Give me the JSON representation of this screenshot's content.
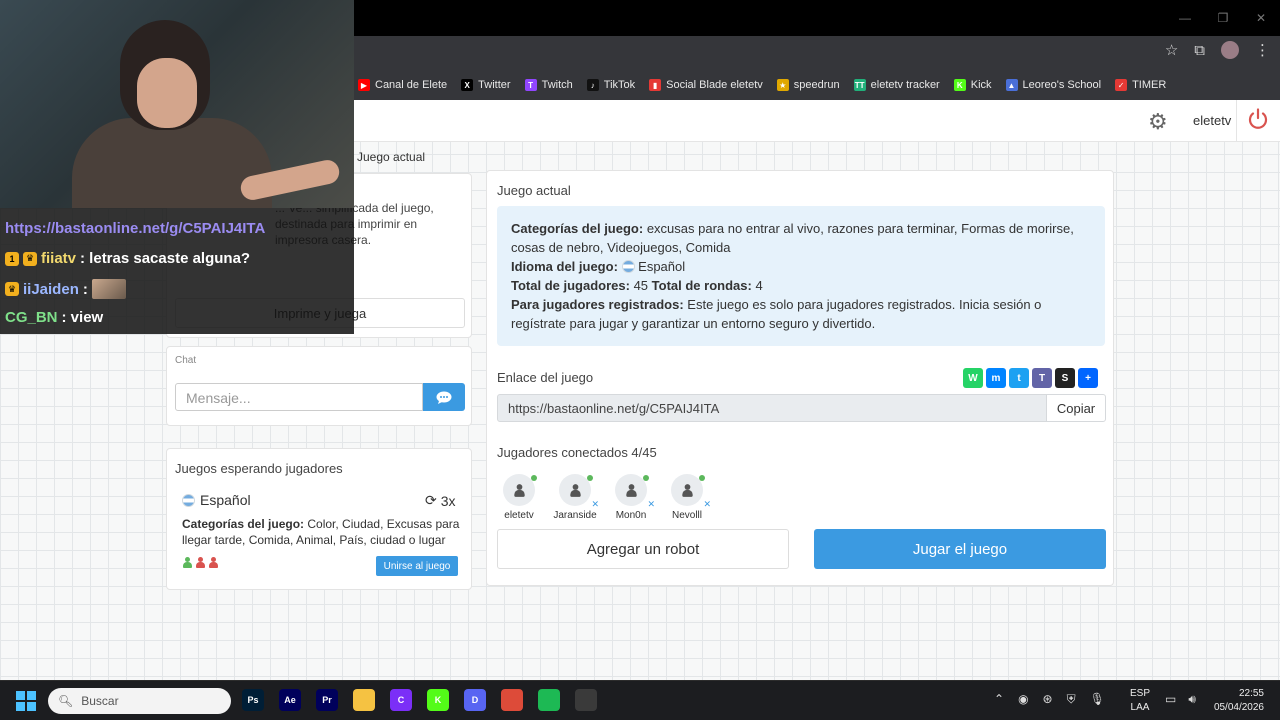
{
  "browser": {
    "bookmarks": [
      {
        "label": "Canal de Elete",
        "icon": "youtube-icon",
        "color": "#ff0000",
        "glyph": "▶"
      },
      {
        "label": "Twitter",
        "icon": "x-icon",
        "color": "#000000",
        "glyph": "X"
      },
      {
        "label": "Twitch",
        "icon": "twitch-icon",
        "color": "#9146ff",
        "glyph": "T"
      },
      {
        "label": "TikTok",
        "icon": "tiktok-icon",
        "color": "#111111",
        "glyph": "♪"
      },
      {
        "label": "Social Blade eletetv",
        "icon": "socialblade-icon",
        "color": "#e53935",
        "glyph": "▮"
      },
      {
        "label": "speedrun",
        "icon": "speedrun-icon",
        "color": "#e0a800",
        "glyph": "★"
      },
      {
        "label": "eletetv tracker",
        "icon": "tracker-icon",
        "color": "#21b07a",
        "glyph": "TT"
      },
      {
        "label": "Kick",
        "icon": "kick-icon",
        "color": "#53fc18",
        "glyph": "K"
      },
      {
        "label": "Leoreo's School",
        "icon": "school-icon",
        "color": "#4a6fd8",
        "glyph": "▲"
      },
      {
        "label": "TIMER",
        "icon": "timer-icon",
        "color": "#e53935",
        "glyph": "✓"
      }
    ]
  },
  "nav": {
    "username": "eletetv"
  },
  "breadcrumb": "Juego actual",
  "print_card": {
    "description": "... Ve... simplificada del juego, destinada para imprimir en impresora casera.",
    "button": "Imprime y juega"
  },
  "chat": {
    "title": "Chat",
    "placeholder": "Mensaje..."
  },
  "waiting": {
    "title": "Juegos esperando jugadores",
    "language": "Español",
    "rounds": "3x",
    "categories_label": "Categorías del juego:",
    "categories": "Color, Ciudad, Excusas para llegar tarde, Comida, Animal, País, ciudad o lugar",
    "players_colors": [
      "#5cb85c",
      "#d9534f",
      "#d9534f"
    ],
    "join_button": "Unirse al juego"
  },
  "game": {
    "title": "Juego actual",
    "categories_label": "Categorías del juego:",
    "categories": "excusas para no entrar al vivo, razones para terminar, Formas de morirse, cosas de nebro, Videojuegos, Comida",
    "language_label": "Idioma del juego:",
    "language": "Español",
    "players_label": "Total de jugadores:",
    "players_total": "45",
    "rounds_label": "Total de rondas:",
    "rounds_total": "4",
    "registered_label": "Para jugadores registrados:",
    "registered_text": "Este juego es solo para jugadores registrados. Inicia sesión o regístrate para jugar y garantizar un entorno seguro y divertido.",
    "link_label": "Enlace del juego",
    "link": "https://bastaonline.net/g/C5PAIJ4ITA",
    "copy_button": "Copiar",
    "connected_label": "Jugadores conectados 4/45",
    "players": [
      {
        "name": "eletetv",
        "host": true
      },
      {
        "name": "Jaranside",
        "host": false
      },
      {
        "name": "Mon0n",
        "host": false
      },
      {
        "name": "Nevolll",
        "host": false
      }
    ],
    "robot_button": "Agregar un robot",
    "play_button": "Jugar el juego",
    "share_icons": [
      {
        "name": "whatsapp-icon",
        "color": "#25d366",
        "glyph": "W"
      },
      {
        "name": "messenger-icon",
        "color": "#0084ff",
        "glyph": "m"
      },
      {
        "name": "twitter-icon",
        "color": "#1da1f2",
        "glyph": "t"
      },
      {
        "name": "teams-icon",
        "color": "#6264a7",
        "glyph": "T"
      },
      {
        "name": "snapchat-icon",
        "color": "#222222",
        "glyph": "S"
      },
      {
        "name": "share-plus-icon",
        "color": "#0166ff",
        "glyph": "+"
      }
    ]
  },
  "stream_chat": {
    "link": "https://bastaonline.net/g/C5PAIJ4ITA",
    "messages": [
      {
        "user": "fiiatv",
        "text": ": letras sacaste alguna?",
        "color": "#f2d96e"
      },
      {
        "user": "iiJaiden",
        "text": ":",
        "color": "#9bb7ff"
      },
      {
        "user": "CG_BN",
        "text": ": view",
        "color": "#7fe08a"
      }
    ]
  },
  "taskbar": {
    "search": "Buscar",
    "apps": [
      {
        "name": "photoshop-icon",
        "label": "Ps",
        "color": "#001e36"
      },
      {
        "name": "after-effects-icon",
        "label": "Ae",
        "color": "#00005b"
      },
      {
        "name": "premiere-icon",
        "label": "Pr",
        "color": "#00005b"
      },
      {
        "name": "file-explorer-icon",
        "label": "",
        "color": "#f5c242"
      },
      {
        "name": "app-c-icon",
        "label": "C",
        "color": "#7b2ff7"
      },
      {
        "name": "kick-app-icon",
        "label": "K",
        "color": "#53fc18"
      },
      {
        "name": "discord-icon",
        "label": "D",
        "color": "#5865f2"
      },
      {
        "name": "chrome-icon",
        "label": "",
        "color": "#dd4b39"
      },
      {
        "name": "spotify-icon",
        "label": "",
        "color": "#1db954"
      },
      {
        "name": "obs-icon",
        "label": "",
        "color": "#3a3a3a"
      }
    ],
    "lang_top": "ESP",
    "lang_bottom": "LAA",
    "time": "22:55",
    "date": "05/04/2026"
  }
}
